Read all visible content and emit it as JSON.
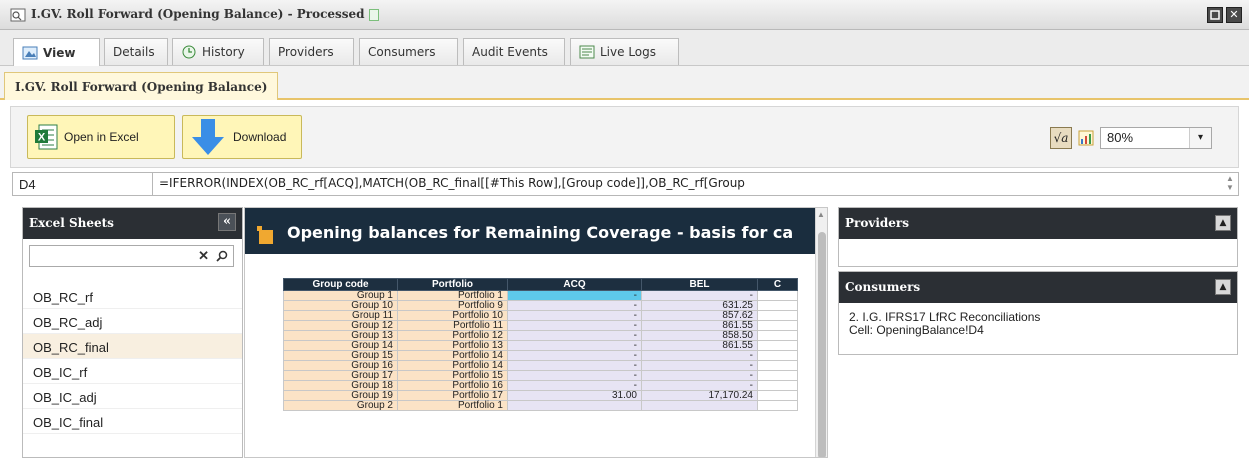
{
  "window": {
    "title": "I.GV. Roll Forward (Opening Balance) - Processed",
    "icon": "report-icon",
    "status_icon": "processed-doc-icon",
    "minmax_icon": "maximize-icon",
    "close_icon": "close-icon"
  },
  "tabs": [
    {
      "label": "View",
      "icon": "view-icon",
      "active": true
    },
    {
      "label": "Details",
      "active": false
    },
    {
      "label": "History",
      "icon": "history-icon",
      "active": false
    },
    {
      "label": "Providers",
      "active": false
    },
    {
      "label": "Consumers",
      "active": false
    },
    {
      "label": "Audit Events",
      "active": false
    },
    {
      "label": "Live Logs",
      "icon": "logs-icon",
      "active": false
    }
  ],
  "subtab": {
    "label": "I.GV. Roll Forward (Opening Balance)"
  },
  "toolbar": {
    "open_excel_label": "Open in Excel",
    "download_label": "Download",
    "zoom_value": "80%",
    "formula_toggle": "√a"
  },
  "formula_bar": {
    "cell_ref": "D4",
    "formula": "=IFERROR(INDEX(OB_RC_rf[ACQ],MATCH(OB_RC_final[[#This Row],[Group code]],OB_RC_rf[Group"
  },
  "excel_sheets": {
    "title": "Excel Sheets",
    "collapse_label": "«",
    "search_value": "",
    "items": [
      {
        "label": "OB_RC_rf",
        "selected": false
      },
      {
        "label": "OB_RC_adj",
        "selected": false
      },
      {
        "label": "OB_RC_final",
        "selected": true
      },
      {
        "label": "OB_IC_rf",
        "selected": false
      },
      {
        "label": "OB_IC_adj",
        "selected": false
      },
      {
        "label": "OB_IC_final",
        "selected": false
      }
    ]
  },
  "sheet": {
    "title": "Opening balances for Remaining Coverage - basis for ca",
    "headers": [
      "Group code",
      "Portfolio",
      "ACQ",
      "BEL",
      "C"
    ],
    "rows": [
      [
        "Group 1",
        "Portfolio 1",
        "-",
        "-"
      ],
      [
        "Group 10",
        "Portfolio 9",
        "-",
        "631.25"
      ],
      [
        "Group 11",
        "Portfolio 10",
        "-",
        "857.62"
      ],
      [
        "Group 12",
        "Portfolio 11",
        "-",
        "861.55"
      ],
      [
        "Group 13",
        "Portfolio 12",
        "-",
        "858.50"
      ],
      [
        "Group 14",
        "Portfolio 13",
        "-",
        "861.55"
      ],
      [
        "Group 15",
        "Portfolio 14",
        "-",
        "-"
      ],
      [
        "Group 16",
        "Portfolio 14",
        "-",
        "-"
      ],
      [
        "Group 17",
        "Portfolio 15",
        "-",
        "-"
      ],
      [
        "Group 18",
        "Portfolio 16",
        "-",
        "-"
      ],
      [
        "Group 19",
        "Portfolio 17",
        "31.00",
        "17,170.24"
      ],
      [
        "Group 2",
        "Portfolio 1",
        "",
        ""
      ]
    ]
  },
  "providers": {
    "title": "Providers"
  },
  "consumers": {
    "title": "Consumers",
    "line1": "2. I.G. IFRS17 LfRC Reconciliations",
    "line2": "Cell: OpeningBalance!D4"
  },
  "colors": {
    "panel_header": "#2b2f34",
    "sheet_header": "#1d2f40",
    "toolbar_button": "#fff6b8",
    "group_cell": "#fbe3c6",
    "value_cell": "#e7e4f4",
    "selected_cell": "#5ec9ea"
  }
}
